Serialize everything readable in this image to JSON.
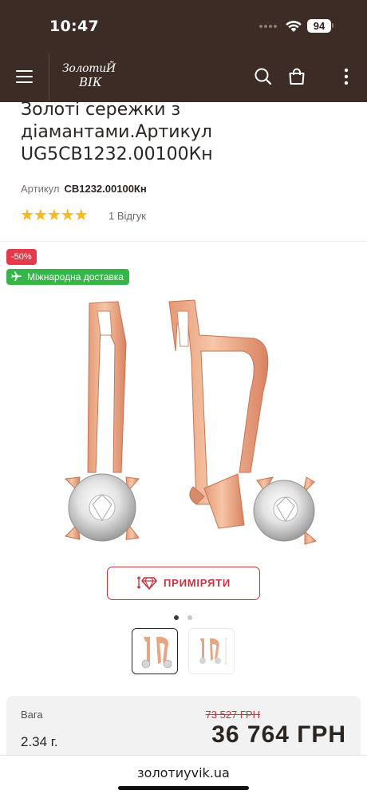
{
  "status_bar": {
    "time": "10:47",
    "battery": "94",
    "icons": [
      "signal-dots-icon",
      "wifi-icon",
      "battery-icon"
    ]
  },
  "header": {
    "logo_line1": "ЗолотиЙ",
    "logo_line2": "ВІК",
    "icons": [
      "menu-icon",
      "search-icon",
      "cart-icon",
      "more-vertical-icon"
    ],
    "background": "#3d2b26"
  },
  "product": {
    "title": "Золоті сережки з діамантами.Артикул UG5CB1232.00100Кн",
    "sku_label": "Артикул",
    "sku_value": "CB1232.00100Кн",
    "rating": 5,
    "rating_stars": "★★★★★",
    "reviews": "1  Відгук"
  },
  "badges": {
    "discount": "-50%",
    "delivery": "Міжнародна доставка"
  },
  "gallery": {
    "image_icon": "earrings-image",
    "try_on_label": "ПРИМІРЯТИ",
    "dots_total": 2,
    "active_dot": 1,
    "thumbnails": [
      "thumbnail-earrings",
      "thumbnail-earrings-dimensions"
    ]
  },
  "price": {
    "weight_label": "Вага",
    "weight_value": "2.34 г.",
    "old_price": "73 527 ГРН",
    "new_price": "36 764 ГРН"
  },
  "browser": {
    "url": "золотиyvik.ua"
  },
  "colors": {
    "brand_dark": "#3d2b26",
    "accent_red": "#c0353e",
    "discount_red": "#e43a4a",
    "delivery_green": "#37b44a",
    "star_gold": "#f6b91e"
  }
}
